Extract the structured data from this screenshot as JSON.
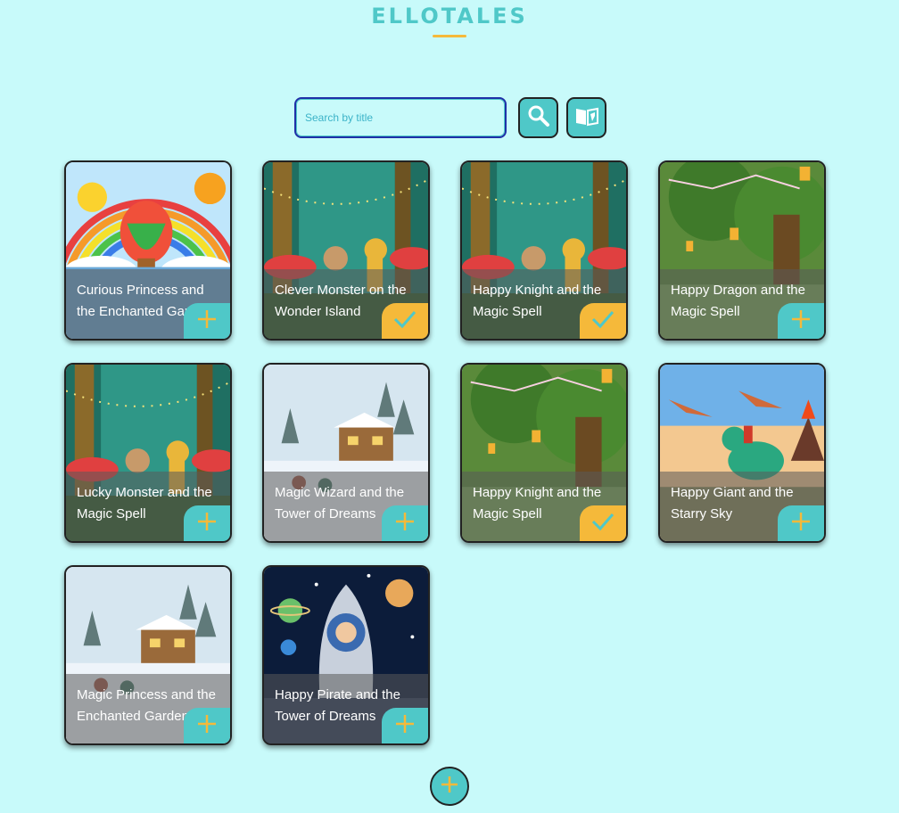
{
  "app": {
    "title": "ELLOTALES"
  },
  "search": {
    "placeholder": "Search by title"
  },
  "toolbar": {
    "search_icon": "magnifier-icon",
    "library_icon": "book-icon"
  },
  "colors": {
    "background": "#c8fafa",
    "accent": "#4fc8c8",
    "highlight": "#f5b93a"
  },
  "stories": [
    {
      "title": "Curious Princess and the Enchanted Garden",
      "scene": "rainbow-balloon",
      "status": "add"
    },
    {
      "title": "Clever Monster on the Wonder Island",
      "scene": "enchanted-forest",
      "status": "done"
    },
    {
      "title": "Happy Knight and the Magic Spell",
      "scene": "enchanted-forest",
      "status": "done"
    },
    {
      "title": "Happy Dragon and the Magic Spell",
      "scene": "lantern-tree",
      "status": "add"
    },
    {
      "title": "Lucky Monster and the Magic Spell",
      "scene": "enchanted-forest",
      "status": "add"
    },
    {
      "title": "Magic Wizard and the Tower of Dreams",
      "scene": "snowy-cottage",
      "status": "add"
    },
    {
      "title": "Happy Knight and the Magic Spell",
      "scene": "lantern-tree",
      "status": "done"
    },
    {
      "title": "Happy Giant and the Starry Sky",
      "scene": "dinosaur-volcano",
      "status": "add"
    },
    {
      "title": "Magic Princess and the Enchanted Garden",
      "scene": "snowy-cottage",
      "status": "add"
    },
    {
      "title": "Happy Pirate and the Tower of Dreams",
      "scene": "space-rocket",
      "status": "add"
    }
  ],
  "fab": {
    "icon": "plus-icon"
  }
}
